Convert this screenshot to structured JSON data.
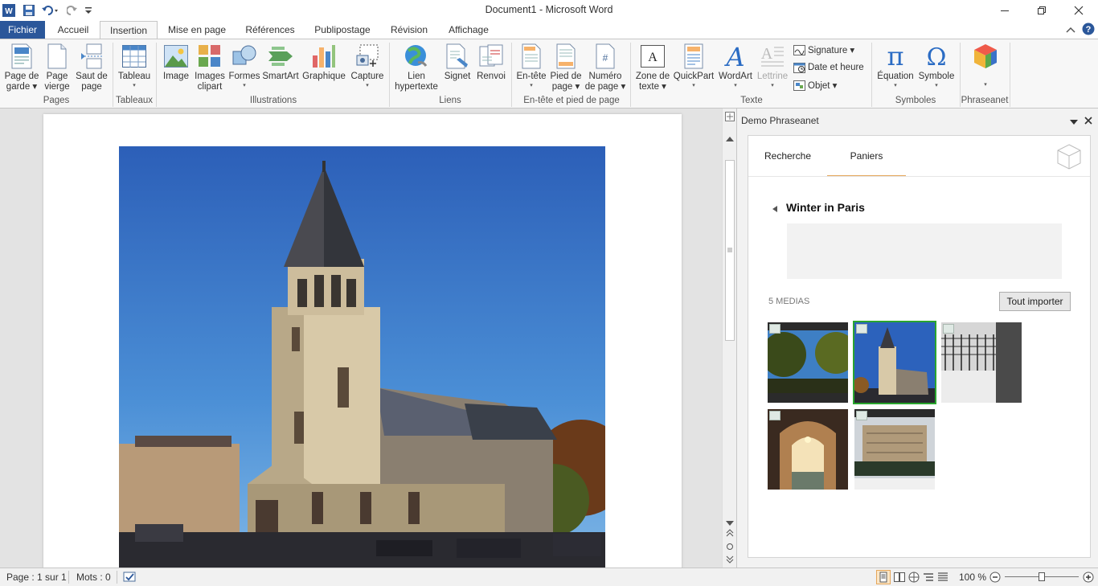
{
  "window": {
    "title": "Document1  -  Microsoft Word"
  },
  "quick_access": {
    "app_icon": "word-logo",
    "icons": [
      "save-icon",
      "undo-icon",
      "redo-icon",
      "customize-icon"
    ]
  },
  "tabs": [
    "Fichier",
    "Accueil",
    "Insertion",
    "Mise en page",
    "Références",
    "Publipostage",
    "Révision",
    "Affichage"
  ],
  "active_tab": "Insertion",
  "ribbon": {
    "pages": {
      "label": "Pages",
      "buttons": [
        {
          "line1": "Page de",
          "line2": "garde ▾"
        },
        {
          "line1": "Page",
          "line2": "vierge"
        },
        {
          "line1": "Saut de",
          "line2": "page"
        }
      ]
    },
    "tableaux": {
      "label": "Tableaux",
      "button": {
        "line1": "Tableau",
        "line2": "▾"
      }
    },
    "illustrations": {
      "label": "Illustrations",
      "buttons": [
        {
          "line1": "Image",
          "line2": ""
        },
        {
          "line1": "Images",
          "line2": "clipart"
        },
        {
          "line1": "Formes",
          "line2": "▾"
        },
        {
          "line1": "SmartArt",
          "line2": ""
        },
        {
          "line1": "Graphique",
          "line2": ""
        },
        {
          "line1": "Capture",
          "line2": "▾"
        }
      ]
    },
    "liens": {
      "label": "Liens",
      "buttons": [
        {
          "line1": "Lien",
          "line2": "hypertexte"
        },
        {
          "line1": "Signet",
          "line2": ""
        },
        {
          "line1": "Renvoi",
          "line2": ""
        }
      ]
    },
    "entete": {
      "label": "En-tête et pied de page",
      "buttons": [
        {
          "line1": "En-tête",
          "line2": "▾"
        },
        {
          "line1": "Pied de",
          "line2": "page ▾"
        },
        {
          "line1": "Numéro",
          "line2": "de page ▾"
        }
      ]
    },
    "texte": {
      "label": "Texte",
      "buttons": [
        {
          "line1": "Zone de",
          "line2": "texte ▾"
        },
        {
          "line1": "QuickPart",
          "line2": "▾"
        },
        {
          "line1": "WordArt",
          "line2": "▾"
        },
        {
          "line1": "Lettrine",
          "line2": "▾"
        }
      ],
      "small": [
        {
          "label": "Signature ▾"
        },
        {
          "label": "Date et heure"
        },
        {
          "label": "Objet ▾"
        }
      ]
    },
    "symboles": {
      "label": "Symboles",
      "buttons": [
        {
          "line1": "Équation",
          "line2": "▾"
        },
        {
          "line1": "Symbole",
          "line2": "▾"
        }
      ]
    },
    "phraseanet": {
      "label": "Phraseanet",
      "button": {
        "line1": "",
        "line2": "▾"
      }
    }
  },
  "task_pane": {
    "title": "Demo Phraseanet",
    "tabs": [
      "Recherche",
      "Paniers"
    ],
    "active_tab": "Paniers",
    "basket_title": "Winter in Paris",
    "media_count": "5 MEDIAS",
    "import_all": "Tout importer",
    "selected_thumbnail": 2,
    "thumbnails": [
      "thumbnail-park",
      "thumbnail-church",
      "thumbnail-snowy-gate",
      "thumbnail-arcade",
      "thumbnail-building"
    ]
  },
  "status": {
    "page": "Page : 1 sur 1",
    "words": "Mots : 0",
    "zoom": "100 %",
    "zoom_level": 1.0
  },
  "colors": {
    "file_tab": "#2b579a",
    "accent_underline": "#e5a65a",
    "selected_border": "#2aa52e",
    "ribbon_bg": "#f7f7f7"
  }
}
